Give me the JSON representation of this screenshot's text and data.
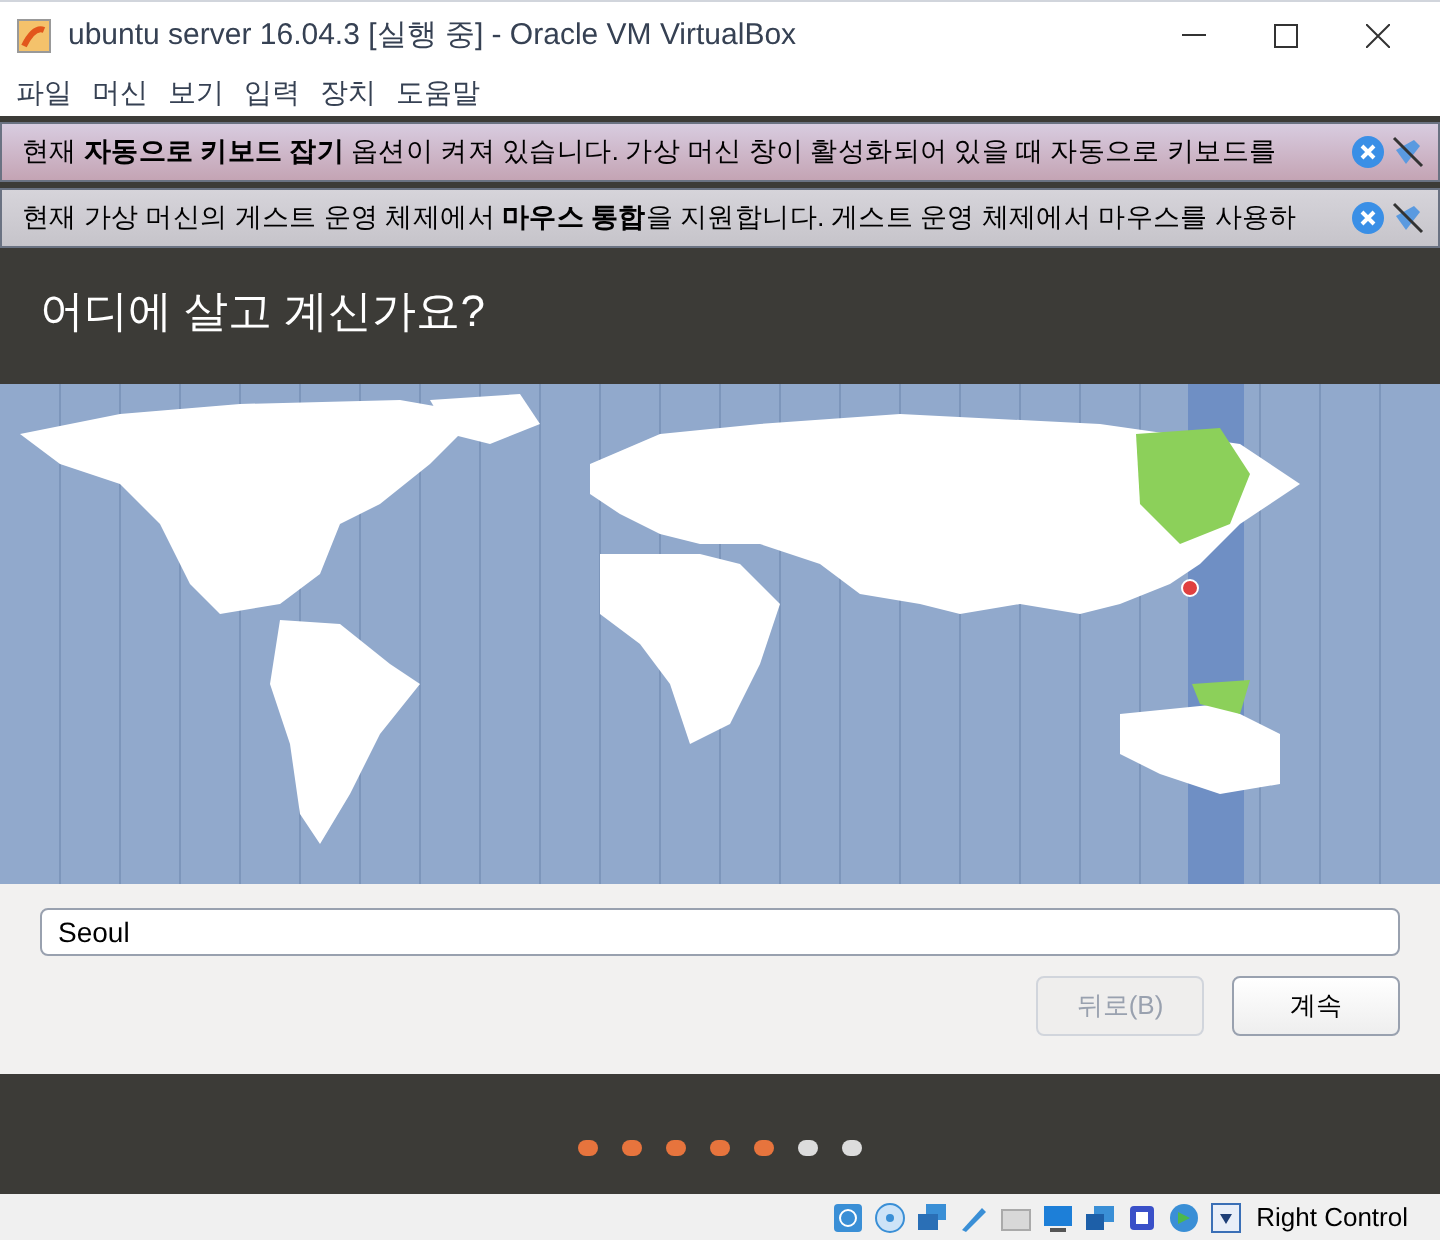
{
  "window": {
    "title": "ubuntu server 16.04.3 [실행 중] - Oracle VM VirtualBox"
  },
  "menu": [
    "파일",
    "머신",
    "보기",
    "입력",
    "장치",
    "도움말"
  ],
  "notices": [
    {
      "text": "현재 **자동으로 키보드 잡기** 옵션이 켜져 있습니다. 가상 머신 창이 활성화되어 있을 때 자동으로 키보드를"
    },
    {
      "text": "현재 가상 머신의 게스트 운영 체제에서 **마우스 통합**을 지원합니다. 게스트 운영 체제에서 마우스를 사용하"
    }
  ],
  "installer": {
    "heading": "어디에 살고 계신가요?",
    "location": {
      "value": "Seoul"
    },
    "buttons": [
      {
        "label": "뒤로(B)",
        "disabled": true
      },
      {
        "label": "계속",
        "disabled": false
      }
    ],
    "steps": [
      {
        "done": true
      },
      {
        "done": true
      },
      {
        "done": true
      },
      {
        "done": true
      },
      {
        "done": true
      },
      {
        "done": false
      },
      {
        "done": false
      }
    ]
  },
  "status_bar": {
    "host_key": "Right Control"
  }
}
